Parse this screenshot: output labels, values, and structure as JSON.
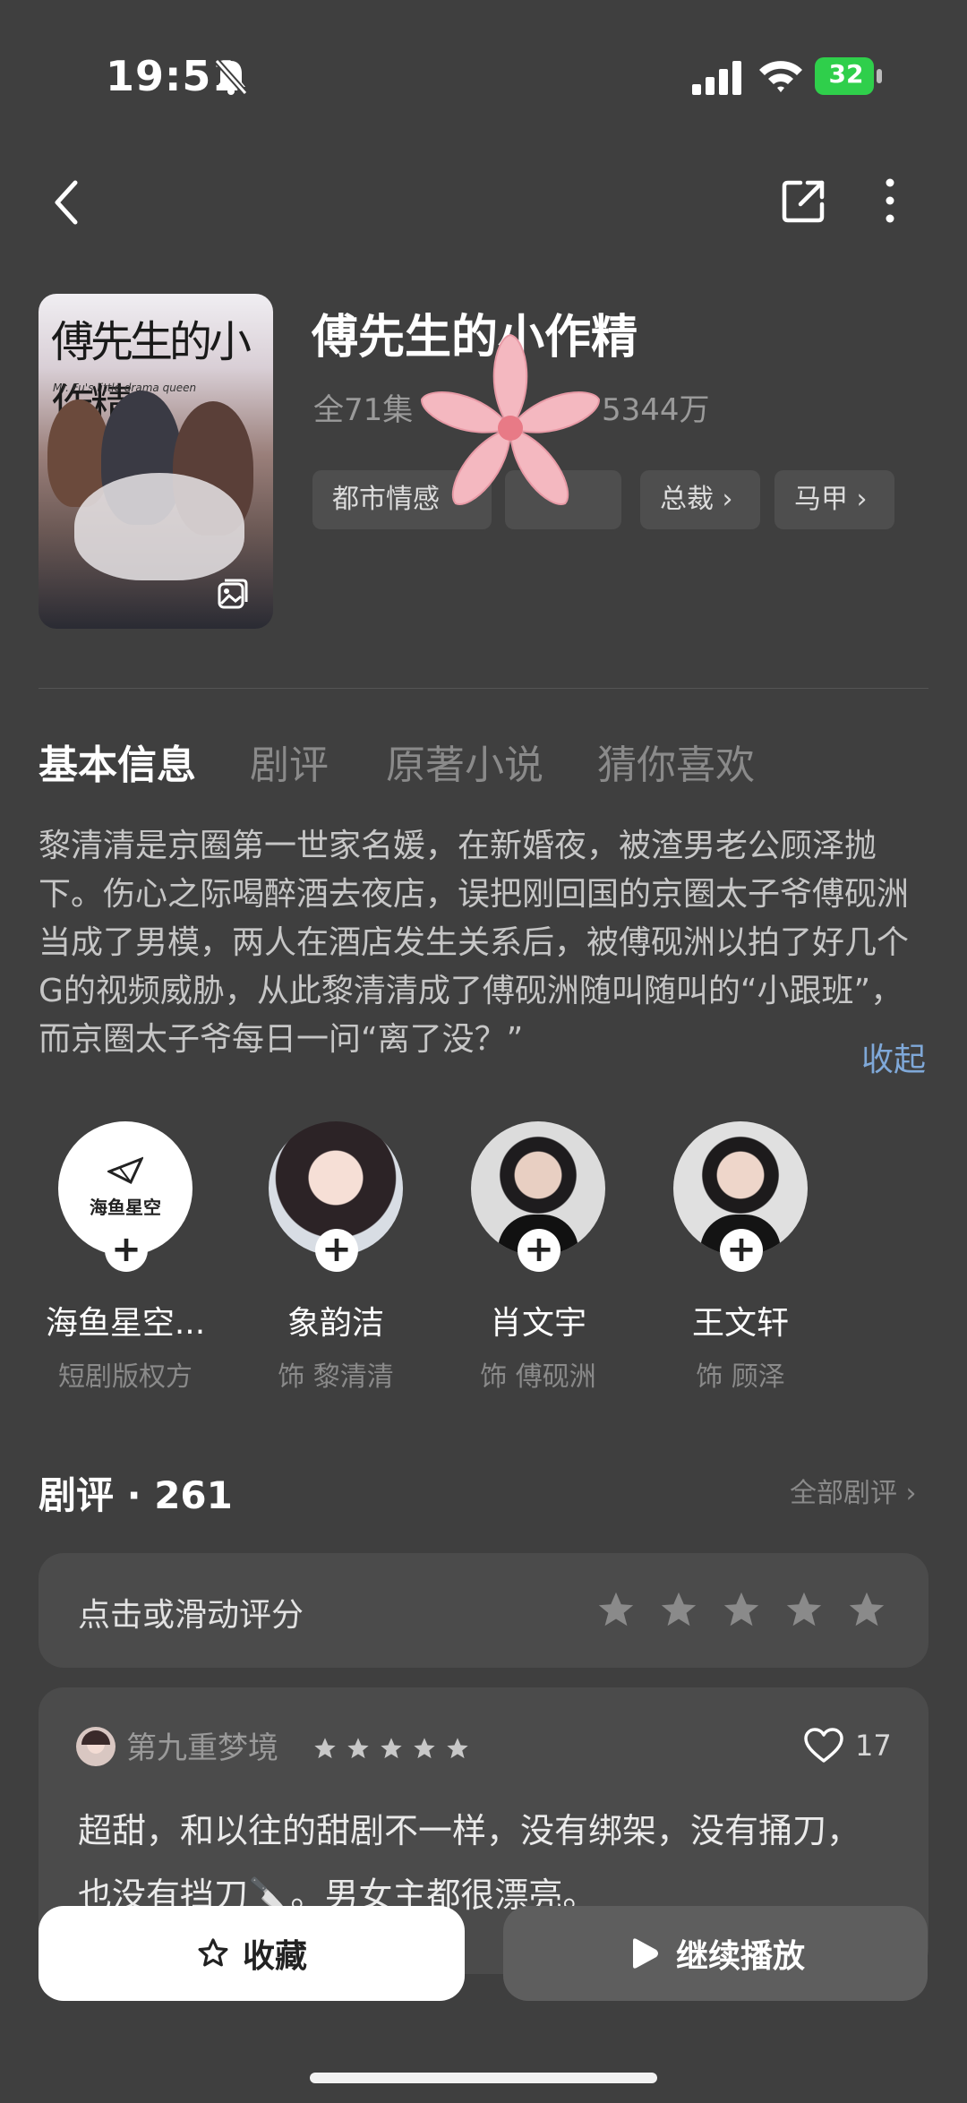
{
  "status_bar": {
    "time": "19:51",
    "battery": "32",
    "icons": [
      "bell-off-icon",
      "signal-icon",
      "wifi-icon",
      "battery-icon"
    ]
  },
  "nav": {
    "icons": [
      "back-icon",
      "share-icon",
      "more-icon"
    ]
  },
  "drama": {
    "title": "傅先生的小作精",
    "meta_left": "全71集",
    "meta_right": "5344万",
    "tags": [
      "都市情感",
      "",
      "总裁 ›",
      "马甲 ›"
    ],
    "poster": {
      "title": "傅先生的小作精",
      "subtitle": "Mr. Fu's little drama queen"
    }
  },
  "tabs": [
    "基本信息",
    "剧评",
    "原著小说",
    "猜你喜欢"
  ],
  "synopsis": {
    "text": "黎清清是京圈第一世家名媛，在新婚夜，被渣男老公顾泽抛下。伤心之际喝醉酒去夜店，误把刚回国的京圈太子爷傅砚洲当成了男模，两人在酒店发生关系后，被傅砚洲以拍了好几个G的视频威胁，从此黎清清成了傅砚洲随叫随叫的“小跟班”，而京圈太子爷每日一问“离了没？”",
    "collapse": "收起"
  },
  "cast": [
    {
      "name": "海鱼星空...",
      "role": "短剧版权方",
      "logo_text": "海鱼星空"
    },
    {
      "name": "象韵洁",
      "role": "饰 黎清清"
    },
    {
      "name": "肖文宇",
      "role": "饰 傅砚洲"
    },
    {
      "name": "王文轩",
      "role": "饰 顾泽"
    }
  ],
  "reviews": {
    "header": "剧评 · 261",
    "all_link": "全部剧评 ›",
    "rate_prompt": "点击或滑动评分",
    "rate_stars": 5,
    "first": {
      "user": "第九重梦境",
      "stars": 5,
      "likes": "17",
      "text": "超甜，和以往的甜剧不一样，没有绑架，没有捅刀，也没有挡刀🔪。男女主都很漂亮。"
    }
  },
  "bottom_bar": {
    "favorite": "收藏",
    "play": "继续播放"
  },
  "colors": {
    "background": "#3f3f3f",
    "card": "#4b4b4b",
    "link": "#7fa8d8",
    "battery": "#2fcf4b"
  }
}
